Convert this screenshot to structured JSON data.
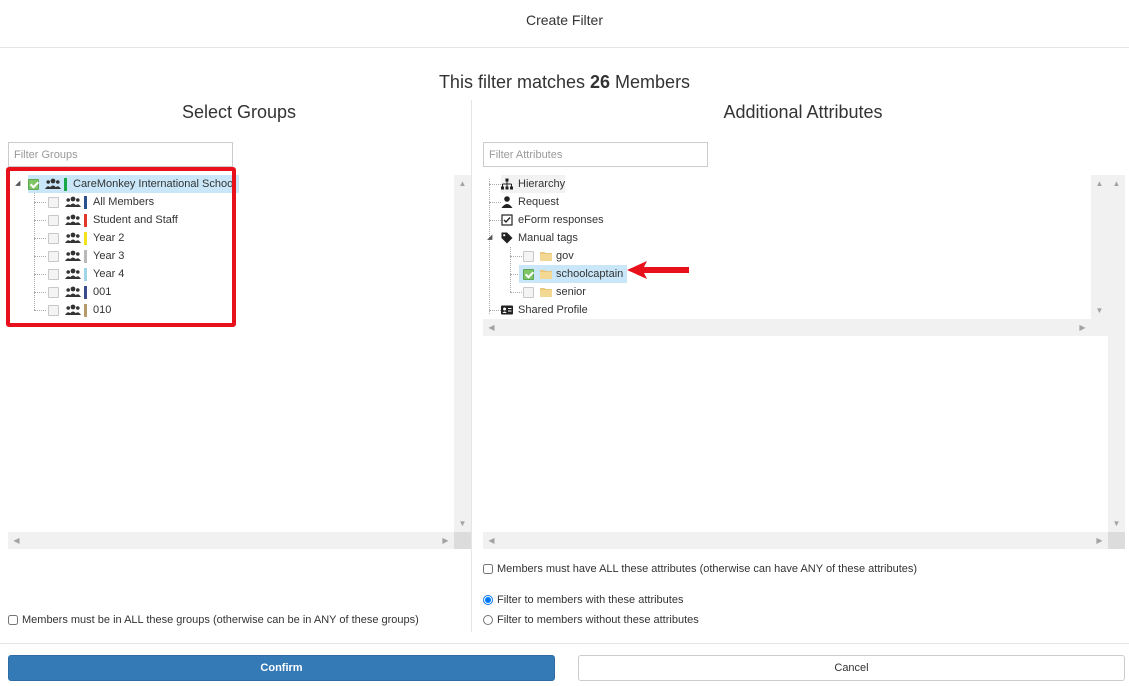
{
  "dialog": {
    "title": "Create Filter"
  },
  "match": {
    "prefix": "This filter matches",
    "count": "26",
    "suffix": "Members"
  },
  "groups": {
    "heading": "Select Groups",
    "filter_placeholder": "Filter Groups",
    "root": {
      "label": "CareMonkey International School",
      "color": "#18a84a",
      "checked": true
    },
    "items": [
      {
        "label": "All Members",
        "color": "#2a4f8f"
      },
      {
        "label": "Student and Staff",
        "color": "#e0392b"
      },
      {
        "label": "Year 2",
        "color": "#f2e31a"
      },
      {
        "label": "Year 3",
        "color": "#b9b9b9"
      },
      {
        "label": "Year 4",
        "color": "#9fd5e8"
      },
      {
        "label": "001",
        "color": "#3b4a8c"
      },
      {
        "label": "010",
        "color": "#b89a6a"
      }
    ],
    "all_groups_option": "Members must be in ALL these groups (otherwise can be in ANY of these groups)"
  },
  "attributes": {
    "heading": "Additional Attributes",
    "filter_placeholder": "Filter Attributes",
    "nodes": {
      "hierarchy": "Hierarchy",
      "request": "Request",
      "eform": "eForm responses",
      "manual_tags": "Manual tags",
      "tag_gov": "gov",
      "tag_schoolcaptain": "schoolcaptain",
      "tag_senior": "senior",
      "shared_profile": "Shared Profile"
    },
    "all_attrs_option": "Members must have ALL these attributes (otherwise can have ANY of these attributes)",
    "filter_with": "Filter to members with these attributes",
    "filter_without": "Filter to members without these attributes"
  },
  "buttons": {
    "confirm": "Confirm",
    "cancel": "Cancel"
  },
  "colors": {
    "primary": "#337ab7",
    "highlight": "#e8101b",
    "selected_row": "#c9e7f8"
  }
}
